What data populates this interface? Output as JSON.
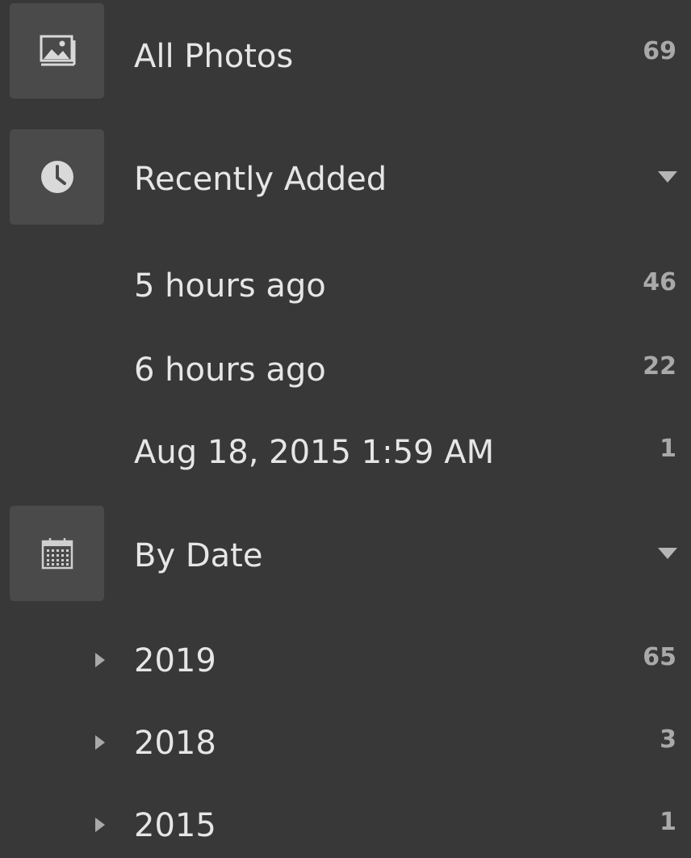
{
  "colors": {
    "background": "#383838",
    "icon_tile": "#4a4a4a",
    "text": "#e6e6e6",
    "count": "#a9a9a9"
  },
  "all_photos": {
    "icon": "image-icon",
    "label": "All Photos",
    "count": "69"
  },
  "recently_added": {
    "icon": "clock-icon",
    "label": "Recently Added",
    "items": [
      {
        "label": "5 hours ago",
        "count": "46"
      },
      {
        "label": "6 hours ago",
        "count": "22"
      },
      {
        "label": "Aug 18, 2015 1:59 AM",
        "count": "1"
      }
    ]
  },
  "by_date": {
    "icon": "calendar-icon",
    "label": "By Date",
    "years": [
      {
        "label": "2019",
        "count": "65"
      },
      {
        "label": "2018",
        "count": "3"
      },
      {
        "label": "2015",
        "count": "1"
      }
    ]
  }
}
